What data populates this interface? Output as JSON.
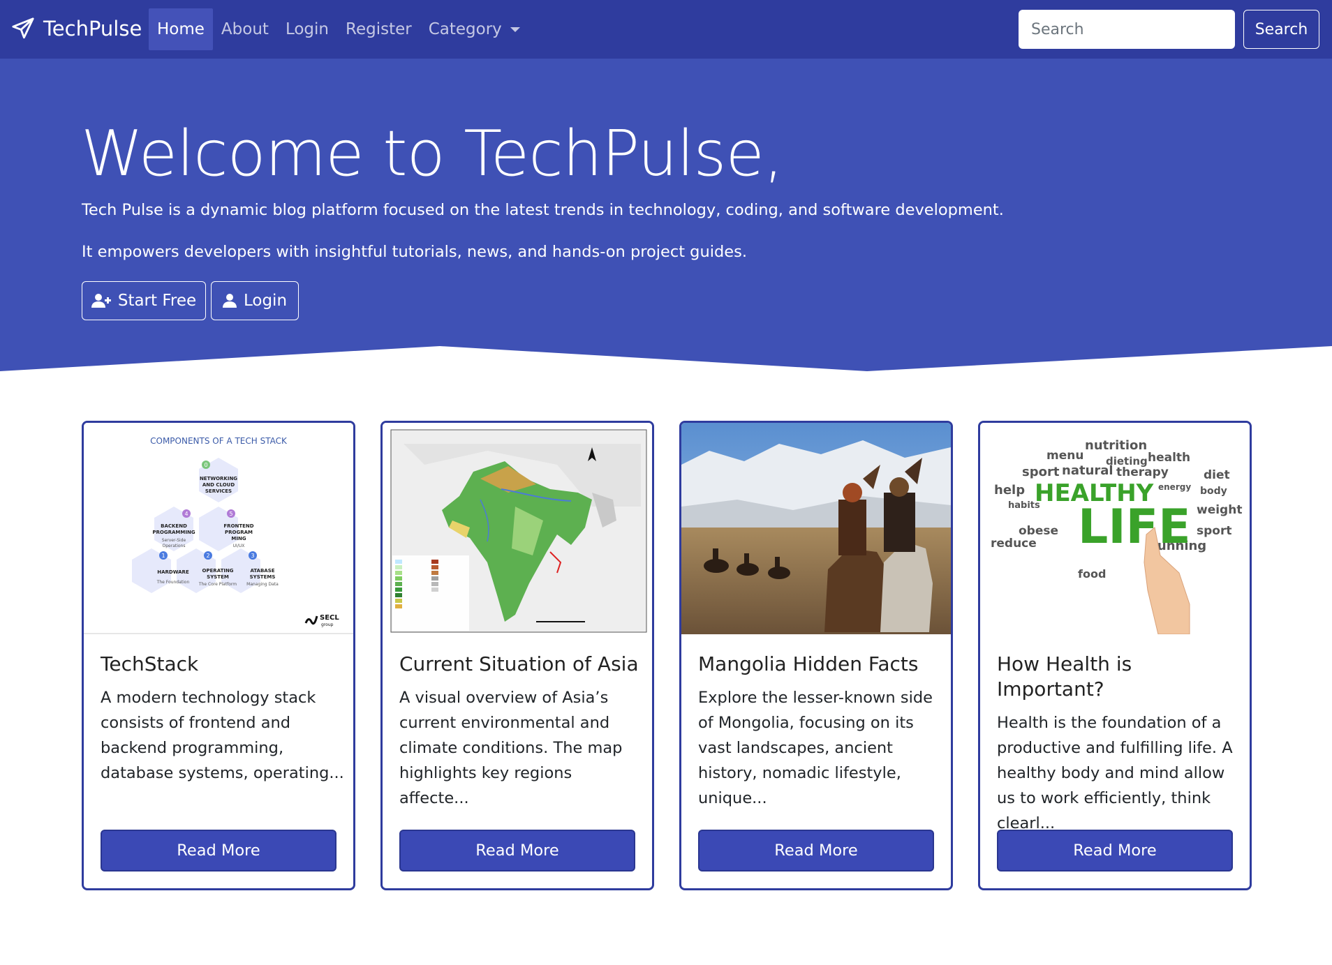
{
  "navbar": {
    "brand": "TechPulse",
    "links": [
      {
        "label": "Home"
      },
      {
        "label": "About"
      },
      {
        "label": "Login"
      },
      {
        "label": "Register"
      },
      {
        "label": "Category"
      }
    ],
    "search_placeholder": "Search",
    "search_button": "Search"
  },
  "hero": {
    "title": "Welcome to TechPulse,",
    "line1": "Tech Pulse is a dynamic blog platform focused on the latest trends in technology, coding, and software development.",
    "line2": "It empowers developers with insightful tutorials, news, and hands-on project guides.",
    "start_label": "Start Free",
    "login_label": "Login"
  },
  "colors": {
    "primary": "#2f3c9e",
    "hero": "#3f51b5",
    "button": "#3b49b5"
  },
  "cards": [
    {
      "title": "TechStack",
      "text": "A modern technology stack consists of frontend and backend programming, database systems, operating...",
      "button": "Read More",
      "image": {
        "heading": "COMPONENTS OF A TECH STACK",
        "hex": [
          {
            "num": "0",
            "l1": "NETWORKING",
            "l2": "AND CLOUD",
            "l3": "SERVICES"
          },
          {
            "num": "4",
            "l1": "BACKEND",
            "l2": "PROGRAMMING",
            "l3": "Server-Side",
            "l4": "Operations"
          },
          {
            "num": "5",
            "l1": "FRONTEND",
            "l2": "PROGRAM",
            "l3": "MING",
            "l4": "UI/UX"
          },
          {
            "num": "1",
            "l1": "HARDWARE",
            "l2": "The Foundation"
          },
          {
            "num": "2",
            "l1": "OPERATING",
            "l2": "SYSTEM",
            "l3": "The Core Platform"
          },
          {
            "num": "3",
            "l1": "ATABASE",
            "l2": "SYSTEMS",
            "l3": "Managing Data"
          }
        ],
        "logo": "SECL",
        "logo_sub": "group"
      }
    },
    {
      "title": "Current Situation of Asia",
      "text": "A visual overview of Asia’s current environmental and climate conditions. The map highlights key regions affecte...",
      "button": "Read More"
    },
    {
      "title": "Mangolia Hidden Facts",
      "text": "Explore the lesser-known side of Mongolia, focusing on its vast landscapes, ancient history, nomadic lifestyle, unique...",
      "button": "Read More"
    },
    {
      "title": "How Health is Important?",
      "text": "Health is the foundation of a productive and fulfilling life. A healthy body and mind allow us to work efficiently, think clearl...",
      "button": "Read More",
      "image": {
        "word1": "HEALTHY",
        "word2": "LIFE",
        "cloud": [
          "nutrition",
          "menu",
          "health",
          "dieting",
          "sport",
          "natural",
          "therapy",
          "diet",
          "help",
          "habits",
          "weight",
          "body",
          "obese",
          "reduce",
          "running",
          "food",
          "sport",
          "energy"
        ]
      }
    }
  ]
}
